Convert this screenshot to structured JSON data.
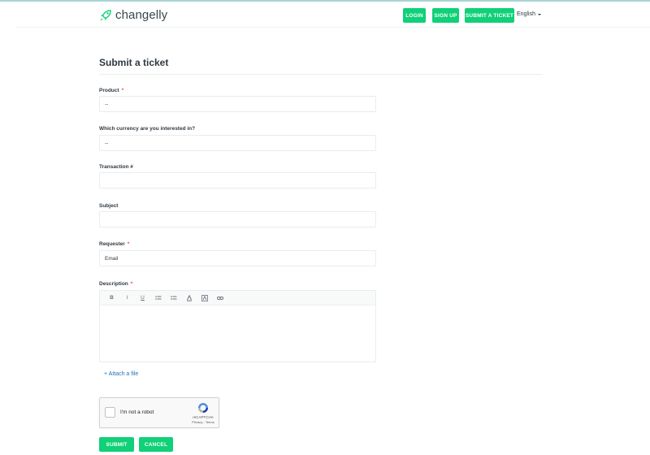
{
  "header": {
    "brand": "changelly",
    "nav": {
      "login": "LOGIN",
      "signup": "SIGN UP",
      "submit_ticket": "SUBMIT A TICKET"
    },
    "language": "English"
  },
  "page": {
    "title": "Submit a ticket"
  },
  "form": {
    "product": {
      "label": "Product",
      "required_mark": "*",
      "value": "--"
    },
    "currency": {
      "label": "Which currency are you interested in?",
      "value": "--"
    },
    "transaction": {
      "label": "Transaction #",
      "value": ""
    },
    "subject": {
      "label": "Subject",
      "value": ""
    },
    "requester": {
      "label": "Requester",
      "required_mark": "*",
      "placeholder": "Email"
    },
    "description": {
      "label": "Description",
      "required_mark": "*",
      "toolbar": [
        "bold-icon",
        "italic-icon",
        "underline-icon",
        "bulleted-list-icon",
        "numbered-list-icon",
        "font-color-icon",
        "highlight-icon",
        "link-icon"
      ],
      "bold": "B",
      "italic": "I",
      "underline": "U"
    },
    "attach_label": "+ Attach a file"
  },
  "captcha": {
    "label": "I'm not a robot",
    "brand": "reCAPTCHA",
    "links": "Privacy - Terms"
  },
  "actions": {
    "submit": "SUBMIT",
    "cancel": "CANCEL"
  },
  "colors": {
    "accent": "#10d078",
    "required": "#e34f32",
    "link": "#1f73b7",
    "text": "#2f3941"
  }
}
